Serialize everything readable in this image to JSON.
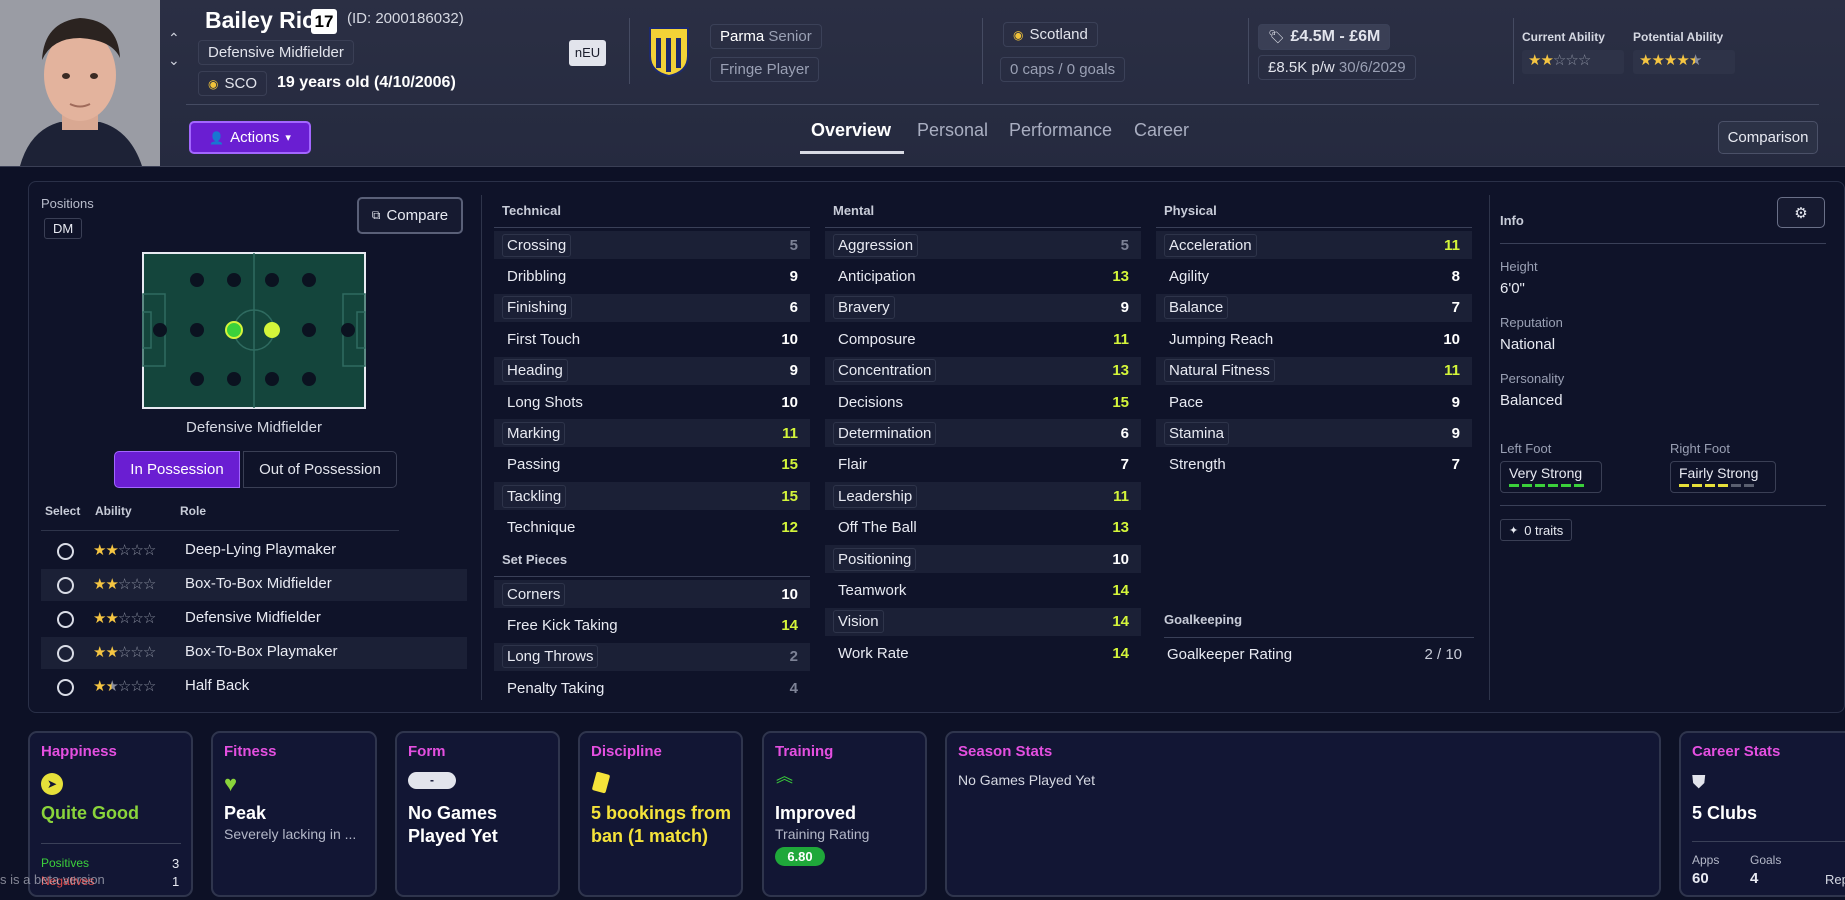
{
  "header": {
    "player_name": "Bailey Rice",
    "squad_number": "17",
    "player_id": "(ID: 2000186032)",
    "position": "Defensive Midfielder",
    "nationality_code": "SCO",
    "age_line": "19 years old (4/10/2006)",
    "neu_badge": "nEU",
    "club": "Parma",
    "squad": "Senior",
    "squad_status": "Fringe Player",
    "nation": "Scotland",
    "caps": "0 caps / 0 goals",
    "value": "£4.5M - £6M",
    "wage": "£8.5K p/w",
    "contract_end": "30/6/2029",
    "current_ability_label": "Current Ability",
    "potential_ability_label": "Potential Ability",
    "current_ability_stars": 2,
    "potential_ability_stars": 4.5,
    "actions_label": "Actions",
    "comparison_label": "Comparison"
  },
  "tabs": [
    {
      "label": "Overview",
      "active": true
    },
    {
      "label": "Personal",
      "active": false
    },
    {
      "label": "Performance",
      "active": false
    },
    {
      "label": "Career",
      "active": false
    }
  ],
  "positions": {
    "title": "Positions",
    "badge": "DM",
    "compare_label": "Compare",
    "pitch_label": "Defensive Midfielder",
    "in_possession_label": "In Possession",
    "out_possession_label": "Out of Possession",
    "col_select": "Select",
    "col_ability": "Ability",
    "col_role": "Role",
    "roles": [
      {
        "name": "Deep-Lying Playmaker",
        "stars": 2
      },
      {
        "name": "Box-To-Box Midfielder",
        "stars": 2
      },
      {
        "name": "Defensive Midfielder",
        "stars": 2
      },
      {
        "name": "Box-To-Box Playmaker",
        "stars": 2
      },
      {
        "name": "Half Back",
        "stars": 1.5
      }
    ]
  },
  "technical": {
    "title": "Technical",
    "attrs": [
      {
        "name": "Crossing",
        "value": "5"
      },
      {
        "name": "Dribbling",
        "value": "9"
      },
      {
        "name": "Finishing",
        "value": "6"
      },
      {
        "name": "First Touch",
        "value": "10"
      },
      {
        "name": "Heading",
        "value": "9"
      },
      {
        "name": "Long Shots",
        "value": "10"
      },
      {
        "name": "Marking",
        "value": "11"
      },
      {
        "name": "Passing",
        "value": "15"
      },
      {
        "name": "Tackling",
        "value": "15"
      },
      {
        "name": "Technique",
        "value": "12"
      }
    ]
  },
  "set_pieces": {
    "title": "Set Pieces",
    "attrs": [
      {
        "name": "Corners",
        "value": "10"
      },
      {
        "name": "Free Kick Taking",
        "value": "14"
      },
      {
        "name": "Long Throws",
        "value": "2"
      },
      {
        "name": "Penalty Taking",
        "value": "4"
      }
    ]
  },
  "mental": {
    "title": "Mental",
    "attrs": [
      {
        "name": "Aggression",
        "value": "5"
      },
      {
        "name": "Anticipation",
        "value": "13"
      },
      {
        "name": "Bravery",
        "value": "9"
      },
      {
        "name": "Composure",
        "value": "11"
      },
      {
        "name": "Concentration",
        "value": "13"
      },
      {
        "name": "Decisions",
        "value": "15"
      },
      {
        "name": "Determination",
        "value": "6"
      },
      {
        "name": "Flair",
        "value": "7"
      },
      {
        "name": "Leadership",
        "value": "11"
      },
      {
        "name": "Off The Ball",
        "value": "13"
      },
      {
        "name": "Positioning",
        "value": "10"
      },
      {
        "name": "Teamwork",
        "value": "14"
      },
      {
        "name": "Vision",
        "value": "14"
      },
      {
        "name": "Work Rate",
        "value": "14"
      }
    ]
  },
  "physical": {
    "title": "Physical",
    "attrs": [
      {
        "name": "Acceleration",
        "value": "11"
      },
      {
        "name": "Agility",
        "value": "8"
      },
      {
        "name": "Balance",
        "value": "7"
      },
      {
        "name": "Jumping Reach",
        "value": "10"
      },
      {
        "name": "Natural Fitness",
        "value": "11"
      },
      {
        "name": "Pace",
        "value": "9"
      },
      {
        "name": "Stamina",
        "value": "9"
      },
      {
        "name": "Strength",
        "value": "7"
      }
    ]
  },
  "goalkeeping": {
    "title": "Goalkeeping",
    "rating_label": "Goalkeeper Rating",
    "rating_value": "2 / 10"
  },
  "info": {
    "title": "Info",
    "height_label": "Height",
    "height": "6'0\"",
    "reputation_label": "Reputation",
    "reputation": "National",
    "personality_label": "Personality",
    "personality": "Balanced",
    "left_foot_label": "Left Foot",
    "left_foot": "Very Strong",
    "right_foot_label": "Right Foot",
    "right_foot": "Fairly Strong",
    "traits": "0 traits"
  },
  "cards": {
    "happiness": {
      "title": "Happiness",
      "value": "Quite Good",
      "positives_label": "Positives",
      "positives": "3",
      "negatives_label": "Negatives",
      "negatives": "1"
    },
    "fitness": {
      "title": "Fitness",
      "value": "Peak",
      "sub": "Severely lacking in ..."
    },
    "form": {
      "title": "Form",
      "badge": "-",
      "value": "No Games Played Yet"
    },
    "discipline": {
      "title": "Discipline",
      "value": "5 bookings from ban (1 match)"
    },
    "training": {
      "title": "Training",
      "value": "Improved",
      "sub": "Training Rating",
      "rating": "6.80"
    },
    "season": {
      "title": "Season Stats",
      "value": "No Games Played Yet"
    },
    "career": {
      "title": "Career Stats",
      "value": "5 Clubs",
      "apps_label": "Apps",
      "apps": "60",
      "goals_label": "Goals",
      "goals": "4",
      "cut_text": "Rep"
    }
  },
  "overlay_text": "s is a beta version",
  "colors": {
    "accent": "#6a1ed2",
    "high": "#d4f53a",
    "mid": "#ffffff",
    "low": "#7d8296",
    "card_title": "#e44fe0",
    "green": "#3bd13b"
  }
}
